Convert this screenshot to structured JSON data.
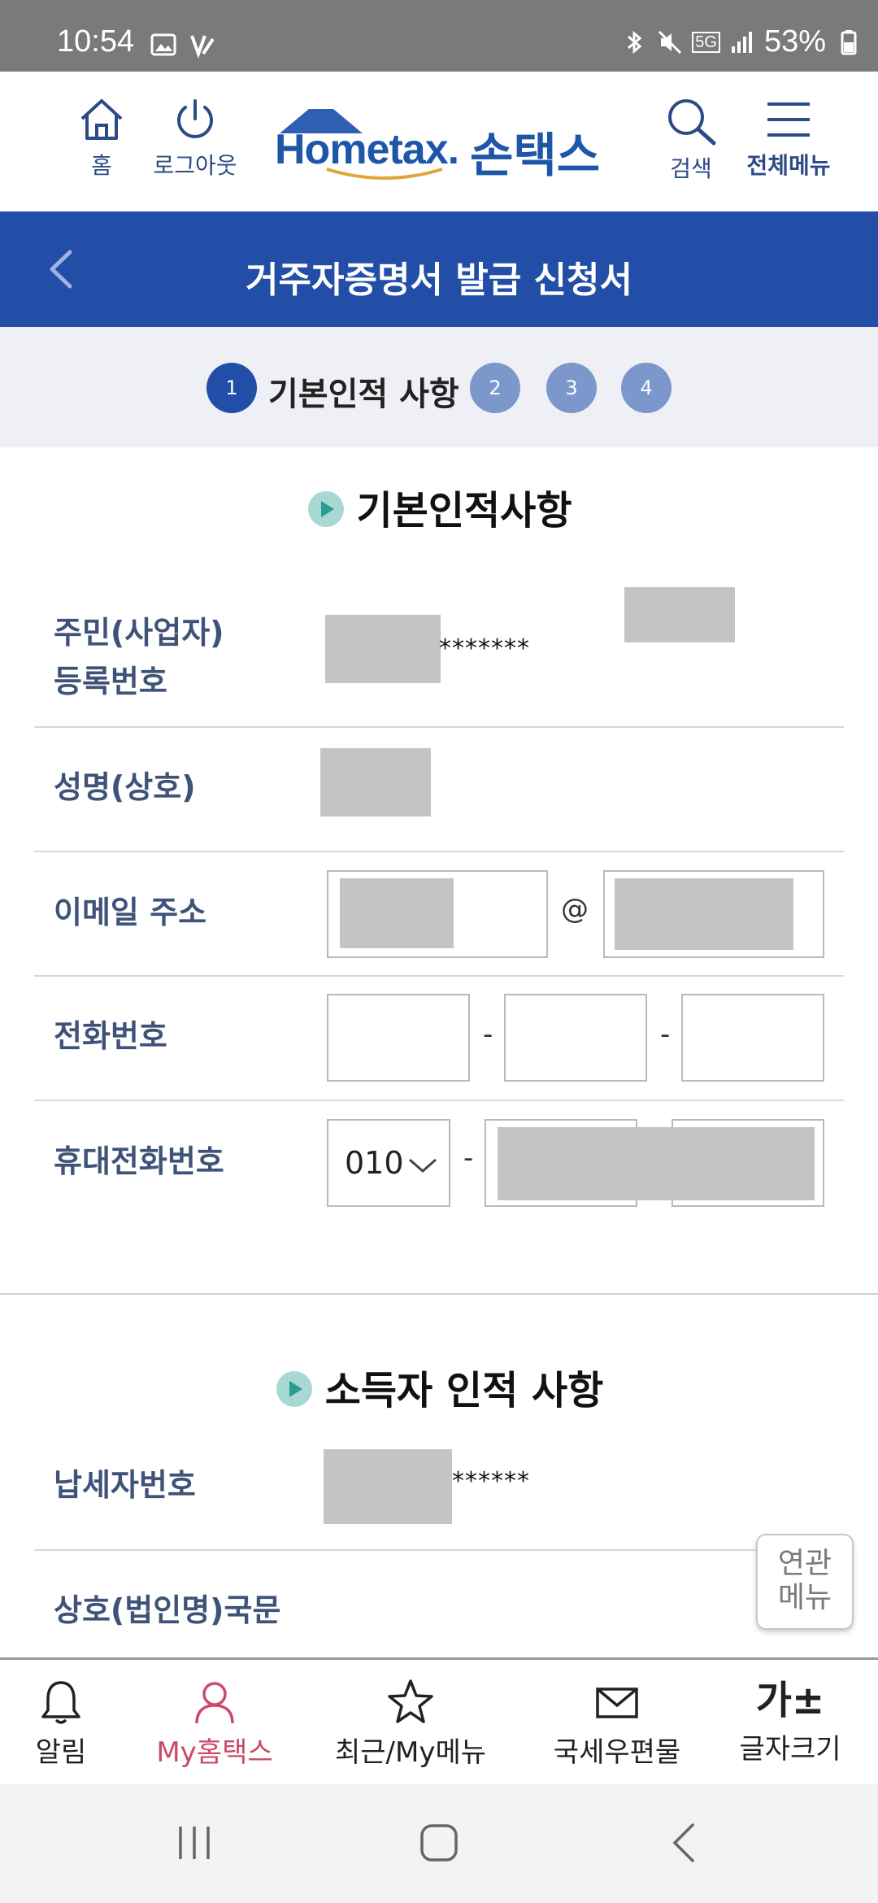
{
  "status_bar": {
    "time": "10:54",
    "battery": "53%",
    "network": "5G"
  },
  "header": {
    "home_label": "홈",
    "logout_label": "로그아웃",
    "logo_text": "Hometax.",
    "logo_kr": "손택스",
    "search_label": "검색",
    "menu_label": "전체메뉴"
  },
  "title_bar": {
    "title": "거주자증명서 발급 신청서"
  },
  "stepper": {
    "steps": [
      "1",
      "2",
      "3",
      "4"
    ],
    "active_label": "기본인적 사항"
  },
  "section1": {
    "title": "기본인적사항",
    "rows": {
      "rrn_label_line1": "주민(사업자)",
      "rrn_label_line2": "등록번호",
      "rrn_masked": "*******",
      "name_label": "성명(상호)",
      "email_label": "이메일 주소",
      "email_at": "@",
      "phone_label": "전화번호",
      "phone_sep": "-",
      "mobile_label": "휴대전화번호",
      "mobile_prefix": "010",
      "mobile_sep": "-"
    }
  },
  "section2": {
    "title": "소득자 인적 사항",
    "taxpayer_label": "납세자번호",
    "taxpayer_masked": "******",
    "company_label": "상호(법인명)국문"
  },
  "related_menu": {
    "line1": "연관",
    "line2": "메뉴"
  },
  "bottom_nav": {
    "items": [
      "알림",
      "My홈택스",
      "최근/My메뉴",
      "국세우편물",
      "글자크기"
    ],
    "font_icon": "가±"
  },
  "colors": {
    "primary": "#234ea8",
    "label": "#3e5377",
    "active_nav": "#c94a6a",
    "mask": "#c4c4c4"
  }
}
